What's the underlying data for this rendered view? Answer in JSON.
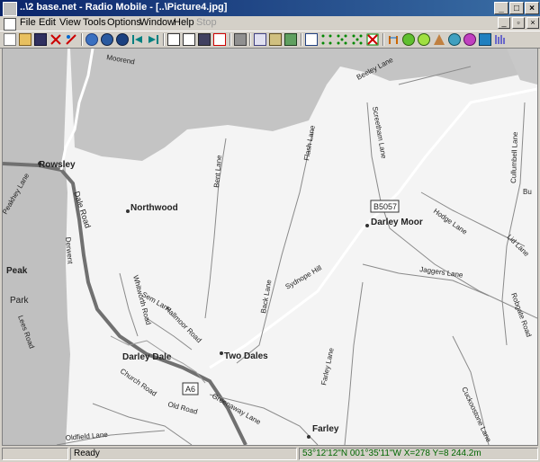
{
  "window": {
    "title": "..\\2 base.net - Radio Mobile - [..\\Picture4.jpg]",
    "controls": {
      "minimize": "_",
      "maximize": "□",
      "close": "×"
    },
    "mdi_controls": {
      "minimize": "_",
      "restore": "▫",
      "close": "×"
    }
  },
  "menu": {
    "items": [
      "File",
      "Edit",
      "View",
      "Tools",
      "Options",
      "Window",
      "Help",
      "Stop"
    ]
  },
  "toolbar": {
    "buttons": [
      "new",
      "open",
      "save",
      "network-properties",
      "antenna",
      "world-map",
      "merge-pictures",
      "picture-properties",
      "previous",
      "next",
      "draw",
      "new-picture",
      "save-picture",
      "export",
      "print",
      "copy",
      "paste",
      "paste-to",
      "window",
      "cartesian",
      "grid",
      "distance",
      "erase",
      "link",
      "radio-coverage",
      "polar-coverage",
      "route-coverage",
      "fresnel",
      "visual",
      "spectrum",
      "bandwidth"
    ]
  },
  "map": {
    "highway_labels": [
      "B5057",
      "A6"
    ],
    "places": [
      "Rowsley",
      "Northwood",
      "Darley Moor",
      "Peak",
      "Park",
      "Darley Dale",
      "Two Dales",
      "Farley"
    ],
    "roads": [
      "Beeley Lane",
      "Screetham Lane",
      "Flash Lane",
      "Bent Lane",
      "Dale Road",
      "Derwent",
      "Peakhey Lane",
      "Lees Road",
      "Whitworth Road",
      "Sem Lane",
      "Hallmoor Road",
      "Back Lane",
      "Sydnope Hill",
      "Jaggers Lane",
      "Hodge Lane",
      "Cullumbell Lane",
      "Lid Lane",
      "Robgate Road",
      "Farley Lane",
      "Church Road",
      "Old Road",
      "Greenaway Lane",
      "Oldfield Lane",
      "Cuckoostone Lane",
      "Moorend",
      "Bu"
    ]
  },
  "status": {
    "ready": "Ready",
    "coordinates": "53°12'12\"N 001°35'11\"W  X=278 Y=8 244.2m"
  },
  "colors": {
    "title_start": "#0a246a",
    "title_end": "#3a6ea5",
    "map_land": "#f4f4f4",
    "map_hills": "#c4c4c4",
    "status_coord_text": "#006600"
  }
}
